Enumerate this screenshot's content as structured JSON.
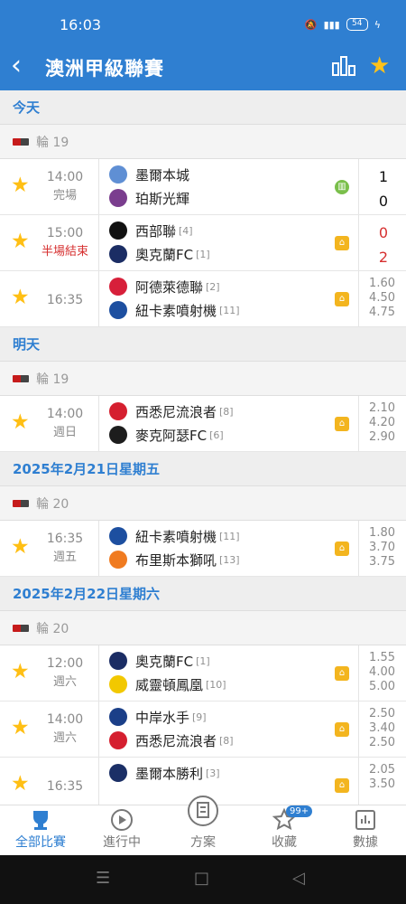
{
  "status_bar": {
    "time": "16:03",
    "battery": "54"
  },
  "header": {
    "title": "澳洲甲級聯賽",
    "back_icon": "chevron-left-icon",
    "stats_icon": "bar-chart-icon",
    "favorite_icon": "star-icon"
  },
  "sections": [
    {
      "date": "今天",
      "round": "輪 19",
      "matches": [
        {
          "time": "14:00",
          "state": "完場",
          "state_red": false,
          "home": "墨爾本城",
          "home_rank": "",
          "away": "珀斯光輝",
          "away_rank": "",
          "score_home": "1",
          "score_away": "0",
          "scores_red": false,
          "odds": [],
          "action_icon": "stats-icon"
        },
        {
          "time": "15:00",
          "state": "半場結束",
          "state_red": true,
          "home": "西部聯",
          "home_rank": "[4]",
          "away": "奧克蘭FC",
          "away_rank": "[1]",
          "score_home": "0",
          "score_away": "2",
          "scores_red": true,
          "odds": [],
          "action_icon": "pitch-icon"
        },
        {
          "time": "16:35",
          "state": "",
          "state_red": false,
          "home": "阿德萊德聯",
          "home_rank": "[2]",
          "away": "紐卡素噴射機",
          "away_rank": "[11]",
          "score_home": "",
          "score_away": "",
          "scores_red": false,
          "odds": [
            "1.60",
            "4.50",
            "4.75"
          ],
          "action_icon": "pitch-icon"
        }
      ]
    },
    {
      "date": "明天",
      "round": "輪 19",
      "matches": [
        {
          "time": "14:00",
          "state": "週日",
          "state_red": false,
          "home": "西悉尼流浪者",
          "home_rank": "[8]",
          "away": "麥克阿瑟FC",
          "away_rank": "[6]",
          "score_home": "",
          "score_away": "",
          "scores_red": false,
          "odds": [
            "2.10",
            "4.20",
            "2.90"
          ],
          "action_icon": "pitch-icon"
        }
      ]
    },
    {
      "date": "2025年2月21日星期五",
      "round": "輪 20",
      "matches": [
        {
          "time": "16:35",
          "state": "週五",
          "state_red": false,
          "home": "紐卡素噴射機",
          "home_rank": "[11]",
          "away": "布里斯本獅吼",
          "away_rank": "[13]",
          "score_home": "",
          "score_away": "",
          "scores_red": false,
          "odds": [
            "1.80",
            "3.70",
            "3.75"
          ],
          "action_icon": "pitch-icon"
        }
      ]
    },
    {
      "date": "2025年2月22日星期六",
      "round": "輪 20",
      "matches": [
        {
          "time": "12:00",
          "state": "週六",
          "state_red": false,
          "home": "奧克蘭FC",
          "home_rank": "[1]",
          "away": "威靈頓鳳凰",
          "away_rank": "[10]",
          "score_home": "",
          "score_away": "",
          "scores_red": false,
          "odds": [
            "1.55",
            "4.00",
            "5.00"
          ],
          "action_icon": "pitch-icon"
        },
        {
          "time": "14:00",
          "state": "週六",
          "state_red": false,
          "home": "中岸水手",
          "home_rank": "[9]",
          "away": "西悉尼流浪者",
          "away_rank": "[8]",
          "score_home": "",
          "score_away": "",
          "scores_red": false,
          "odds": [
            "2.50",
            "3.40",
            "2.50"
          ],
          "action_icon": "pitch-icon"
        },
        {
          "time": "16:35",
          "state": "",
          "state_red": false,
          "home": "墨爾本勝利",
          "home_rank": "[3]",
          "away": "",
          "away_rank": "",
          "score_home": "",
          "score_away": "",
          "scores_red": false,
          "odds": [
            "2.05",
            "3.50"
          ],
          "action_icon": "pitch-icon"
        }
      ]
    }
  ],
  "bottom_nav": {
    "tabs": [
      {
        "label": "全部比賽",
        "icon": "trophy-icon",
        "active": true
      },
      {
        "label": "進行中",
        "icon": "play-icon",
        "active": false
      },
      {
        "label": "方案",
        "icon": "document-icon",
        "active": false
      },
      {
        "label": "收藏",
        "icon": "star-outline-icon",
        "active": false,
        "badge": "99+"
      },
      {
        "label": "數據",
        "icon": "chart-icon",
        "active": false
      }
    ]
  },
  "colors": {
    "primary": "#2f7fd1",
    "star": "#ffbf14",
    "red": "#d62f2f",
    "gray_text": "#8a8a8a"
  }
}
